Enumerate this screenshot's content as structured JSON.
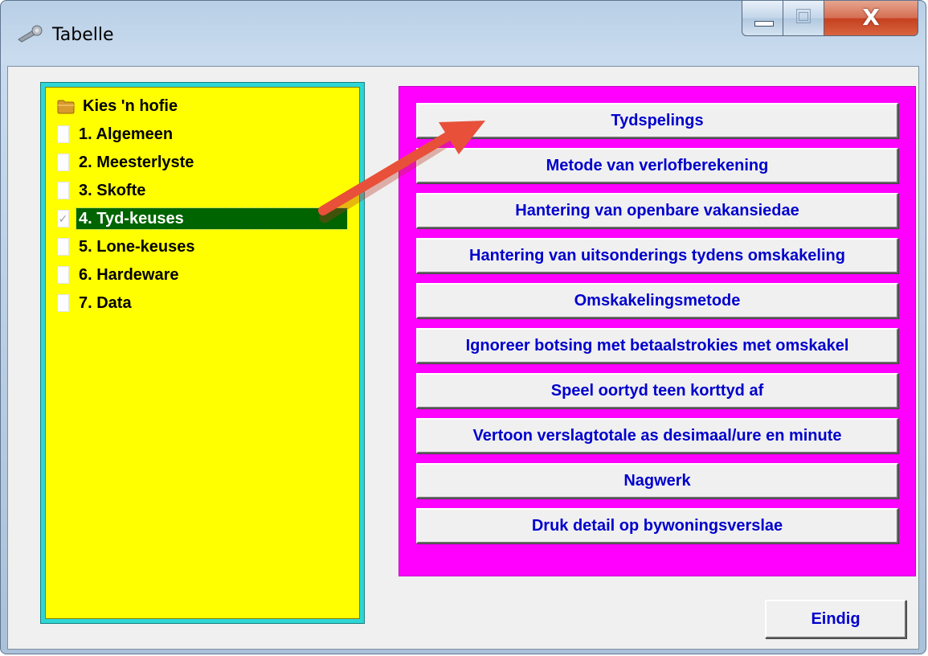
{
  "window": {
    "title": "Tabelle",
    "icon": "wrench-key-icon",
    "controls": [
      "minimize-icon",
      "maximize-icon",
      "close-icon"
    ],
    "close_glyph": "X"
  },
  "tree": {
    "root_label": "Kies 'n hofie",
    "items": [
      {
        "label": "1. Algemeen",
        "icon": "document-icon"
      },
      {
        "label": "2. Meesterlyste",
        "icon": "document-icon"
      },
      {
        "label": "3. Skofte",
        "icon": "document-icon"
      },
      {
        "label": "4. Tyd-keuses",
        "icon": "checked-document-icon",
        "selected": true
      },
      {
        "label": "5. Lone-keuses",
        "icon": "document-icon"
      },
      {
        "label": "6. Hardeware",
        "icon": "document-icon"
      },
      {
        "label": "7. Data",
        "icon": "document-icon"
      }
    ]
  },
  "options": [
    "Tydspelings",
    "Metode van verlofberekening",
    "Hantering van openbare vakansiedae",
    "Hantering van uitsonderings tydens omskakeling",
    "Omskakelingsmetode",
    "Ignoreer botsing met betaalstrokies met omskakel",
    "Speel oortyd teen korttyd af",
    "Vertoon verslagtotale as desimaal/ure en minute",
    "Nagwerk",
    "Druk detail op bywoningsverslae"
  ],
  "footer": {
    "end_label": "Eindig"
  },
  "colors": {
    "tree_background": "#ffff00",
    "tree_border": "#2ed6d6",
    "selection": "#006400",
    "panel_background": "#ff00ff",
    "button_text": "#0000cd",
    "annotation_arrow": "#e8503a"
  }
}
